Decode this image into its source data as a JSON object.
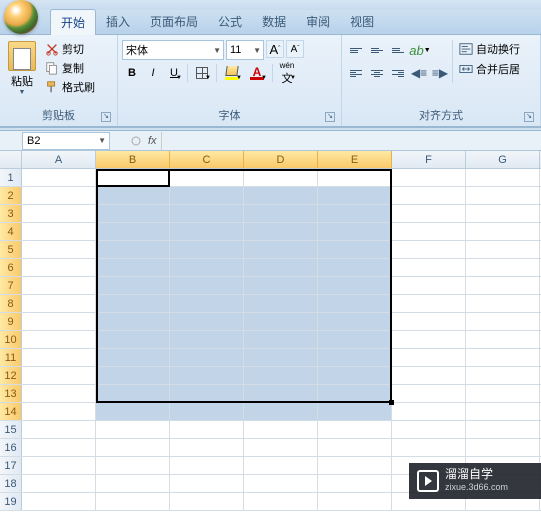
{
  "tabs": {
    "start": "开始",
    "insert": "插入",
    "page_layout": "页面布局",
    "formulas": "公式",
    "data": "数据",
    "review": "审阅",
    "view": "视图"
  },
  "clipboard": {
    "paste": "粘贴",
    "cut": "剪切",
    "copy": "复制",
    "format_painter": "格式刷",
    "group_label": "剪贴板"
  },
  "font": {
    "name": "宋体",
    "size": "11",
    "bold": "B",
    "italic": "I",
    "underline": "U",
    "grow_A": "A",
    "shrink_A": "A",
    "wen": "wén",
    "group_label": "字体"
  },
  "alignment": {
    "wrap": "自动换行",
    "merge": "合并后居",
    "group_label": "对齐方式"
  },
  "name_box": "B2",
  "fx": "fx",
  "columns": [
    "A",
    "B",
    "C",
    "D",
    "E",
    "F",
    "G"
  ],
  "rows": [
    "1",
    "2",
    "3",
    "4",
    "5",
    "6",
    "7",
    "8",
    "9",
    "10",
    "11",
    "12",
    "13",
    "14",
    "15",
    "16",
    "17",
    "18",
    "19"
  ],
  "watermark": {
    "title": "溜溜自学",
    "url": "zixue.3d66.com"
  }
}
